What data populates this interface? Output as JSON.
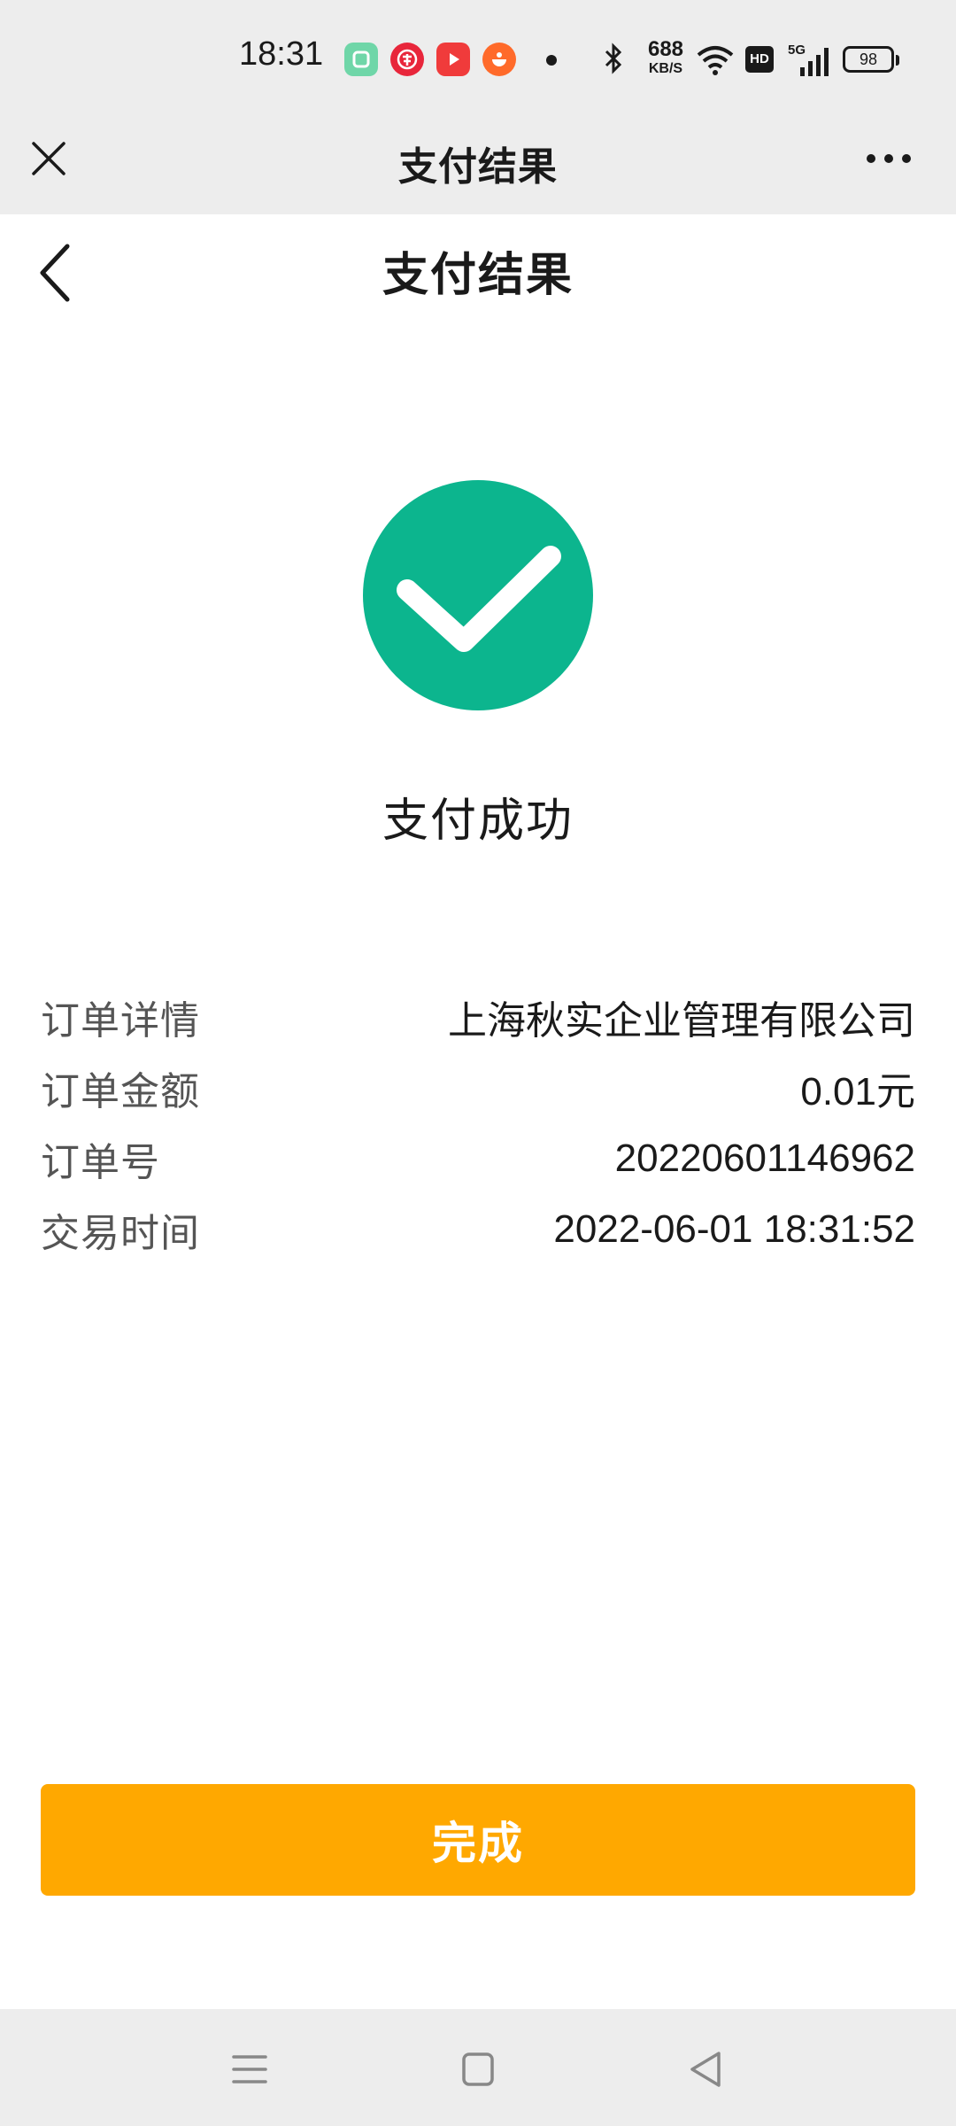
{
  "status_bar": {
    "time": "18:31",
    "network_speed_value": "688",
    "network_speed_unit": "KB/S",
    "battery": "98",
    "hd_label": "HD",
    "network_type": "5G"
  },
  "outer_bar": {
    "title": "支付结果"
  },
  "page_header": {
    "title": "支付结果"
  },
  "result": {
    "status_text": "支付成功",
    "accent_color": "#0cb58e"
  },
  "details": [
    {
      "label": "订单详情",
      "value": "上海秋实企业管理有限公司"
    },
    {
      "label": "订单金额",
      "value": "0.01元"
    },
    {
      "label": "订单号",
      "value": "20220601146962"
    },
    {
      "label": "交易时间",
      "value": "2022-06-01 18:31:52"
    }
  ],
  "done_button": {
    "label": "完成",
    "color": "#ffa800"
  },
  "icons": {
    "close": "close-icon",
    "more": "more-icon",
    "back": "back-icon",
    "success": "check-circle-icon",
    "nav_menu": "menu-icon",
    "nav_home": "home-icon",
    "nav_back": "triangle-back-icon"
  }
}
